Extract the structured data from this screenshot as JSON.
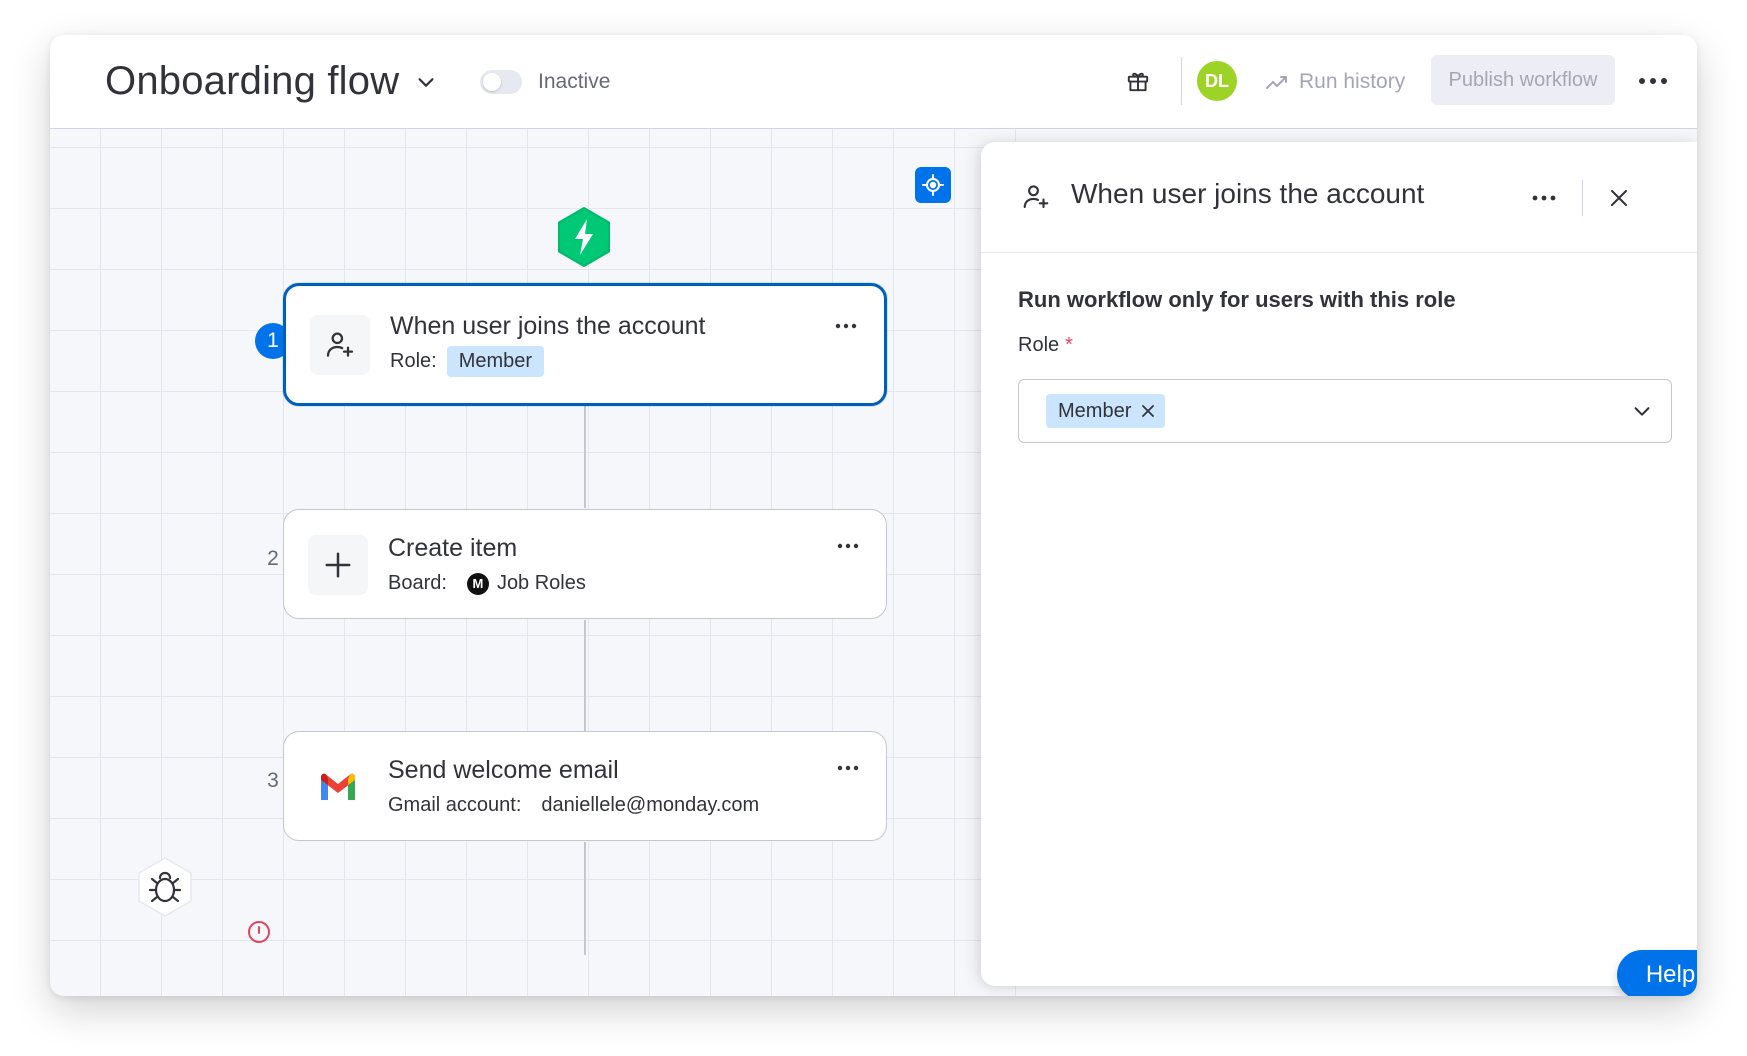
{
  "header": {
    "title": "Onboarding flow",
    "status_label": "Inactive",
    "avatar_initials": "DL",
    "run_history_label": "Run history",
    "publish_label": "Publish workflow",
    "icons": [
      "chevron-down-icon",
      "gift-icon",
      "trend-icon",
      "more-icon"
    ]
  },
  "canvas": {
    "nodes": [
      {
        "step": "1",
        "title": "When user joins the account",
        "sub_label": "Role:",
        "sub_value": "Member",
        "icon": "user-add-icon",
        "selected": true
      },
      {
        "step": "2",
        "title": "Create item",
        "sub_label": "Board:",
        "sub_badge": "M",
        "sub_value": "Job Roles",
        "icon": "plus-icon"
      },
      {
        "step": "3",
        "title": "Send welcome email",
        "sub_label": "Gmail account:",
        "sub_value": "daniellele@monday.com",
        "icon": "gmail-icon"
      }
    ],
    "icons": [
      "locate-icon",
      "lightning-icon",
      "bug-icon",
      "error-icon"
    ]
  },
  "panel": {
    "title": "When user joins the account",
    "heading": "Run workflow only for users with this role",
    "field_label": "Role",
    "required_mark": "*",
    "selected_values": [
      "Member"
    ],
    "help_label": "Help",
    "icons": [
      "user-add-icon",
      "more-icon",
      "close-icon",
      "chevron-down-icon"
    ]
  },
  "colors": {
    "primary": "#0073ea",
    "selected_border": "#0060b9",
    "chip": "#cce5ff",
    "trigger_green": "#00c875",
    "avatar_green": "#9cd326",
    "required": "#e2445c"
  }
}
